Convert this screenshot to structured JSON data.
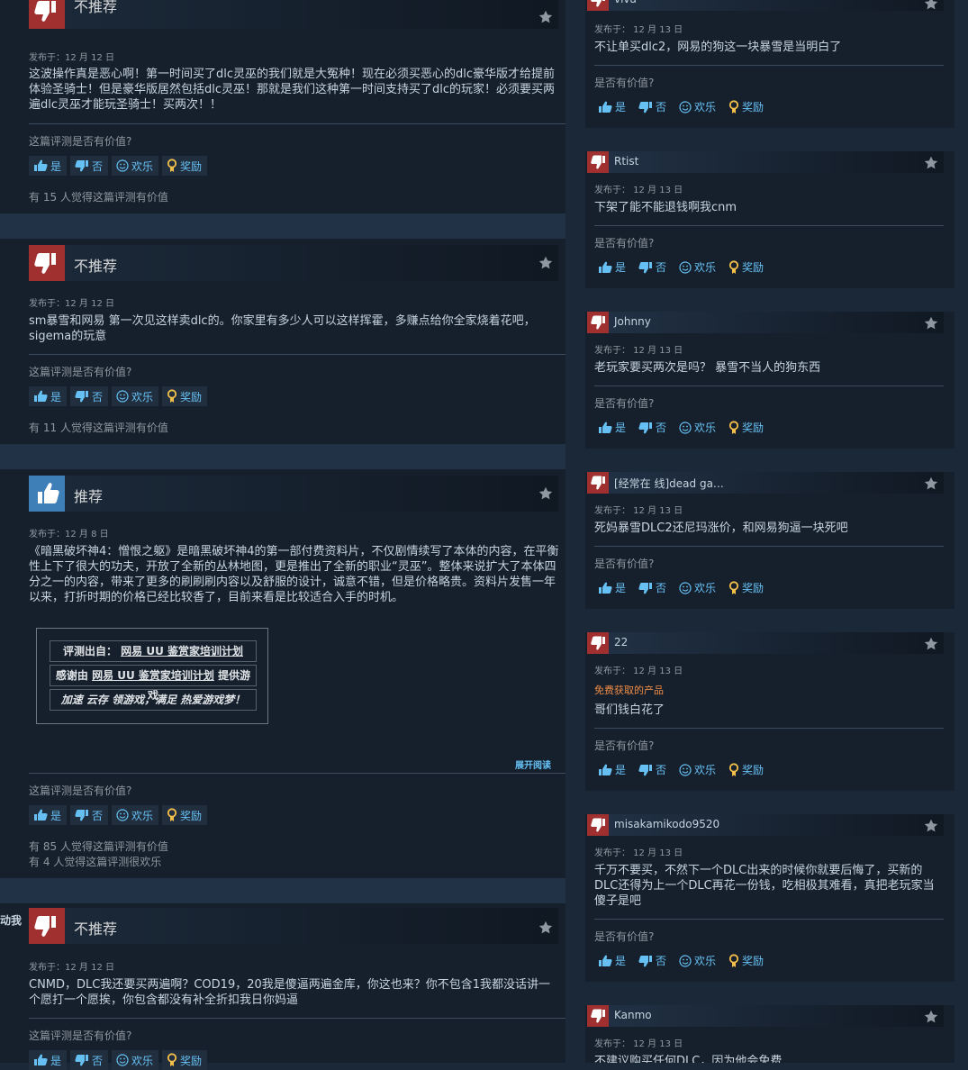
{
  "labels": {
    "helpful_q": "这篇评测是否有价值?",
    "right_helpful_q": "是否有价值?",
    "yes": "是",
    "no": "否",
    "funny": "欢乐",
    "award": "奖励",
    "expand": "展开阅读"
  },
  "left_reviews": [
    {
      "verdict": "不推荐",
      "posted": "发布于：12 月 12 日",
      "text": "这波操作真是恶心啊！第一时间买了dlc灵巫的我们就是大冤种！现在必须买恶心的dlc豪华版才给提前体验圣骑士！但是豪华版居然包括dlc灵巫！那就是我们这种第一时间支持买了dlc的玩家！必须要买两遍dlc灵巫才能玩圣骑士！买两次！！",
      "count1": "有 15 人觉得这篇评测有价值"
    },
    {
      "verdict": "不推荐",
      "posted": "发布于：12 月 12 日",
      "text": "sm暴雪和网易 第一次见这样卖dlc的。你家里有多少人可以这样挥霍，多赚点给你全家烧着花吧，sigema的玩意",
      "count1": "有 11 人觉得这篇评测有价值"
    },
    {
      "verdict": "推荐",
      "posted": "发布于：12 月 8 日",
      "text": "《暗黑破坏神4：憎恨之躯》是暗黑破坏神4的第一部付费资料片，不仅剧情续写了本体的内容，在平衡性上下了很大的功夫，开放了全新的丛林地图，更是推出了全新的职业“灵巫”。整体来说扩大了本体四分之一的内容，带来了更多的刷刷刷内容以及舒服的设计，诚意不错，但是价格略贵。资料片发售一年以来，打折时期的价格已经比较香了，目前来看是比较适合入手的时机。",
      "curator_label1": "评测出自：",
      "curator_link1": "网易 UU 鉴赏家培训计划",
      "curator_label2a": "感谢由",
      "curator_link2": "网易 UU 鉴赏家培训计划",
      "curator_label2b": "提供游戏",
      "curator_slogan": "加速 云存 领游戏，满足 热爱游戏梦！",
      "count1": "有 85 人觉得这篇评测有价值",
      "count2": "有 4 人觉得这篇评测很欢乐"
    },
    {
      "verdict": "不推荐",
      "posted": "发布于：12 月 12 日",
      "text": "CNMD，DLC我还要买两遍啊？COD19，20我是傻逼两遍金库，你这也来？你不包含1我都没话讲一个愿打一个愿挨，你包含都没有补全折扣我日你妈逼"
    }
  ],
  "edge_text": "动我",
  "right_reviews": [
    {
      "name": "viva",
      "posted": "发布于： 12 月 13 日",
      "text": "不让单买dlc2，网易的狗这一块暴雪是当明白了"
    },
    {
      "name": "Rtist",
      "posted": "发布于： 12 月 13 日",
      "text": "下架了能不能退钱啊我cnm"
    },
    {
      "name": "Johnny",
      "posted": "发布于： 12 月 13 日",
      "text": "老玩家要买两次是吗？ 暴雪不当人的狗东西"
    },
    {
      "name": "[经常在 线]dead ga…",
      "posted": "发布于： 12 月 13 日",
      "text": "死妈暴雪DLC2还尼玛涨价，和网易狗逼一块死吧"
    },
    {
      "name": "22",
      "posted": "发布于： 12 月 13 日",
      "free": "免费获取的产品",
      "text": "哥们钱白花了"
    },
    {
      "name": "misakamikodo9520",
      "posted": "发布于： 12 月 13 日",
      "text": "千万不要买，不然下一个DLC出来的时候你就要后悔了，买新的DLC还得为上一个DLC再花一份钱，吃相极其难看，真把老玩家当傻子是吧"
    },
    {
      "name": "Kanmo",
      "posted": "发布于： 12 月 13 日",
      "text": "不建议购买任何DLC，因为他会免费"
    }
  ],
  "colors": {
    "page_bg": "#1b2838",
    "card_bg": "#16202d",
    "thumbs_down": "#a0302f",
    "thumbs_up": "#3f7fb8",
    "link": "#66c0f4",
    "award": "#f5c04a",
    "free_tag": "#ef8c45"
  },
  "icons": [
    "thumbs-down-icon",
    "thumbs-up-icon",
    "star-icon",
    "smiley-icon",
    "award-icon"
  ]
}
